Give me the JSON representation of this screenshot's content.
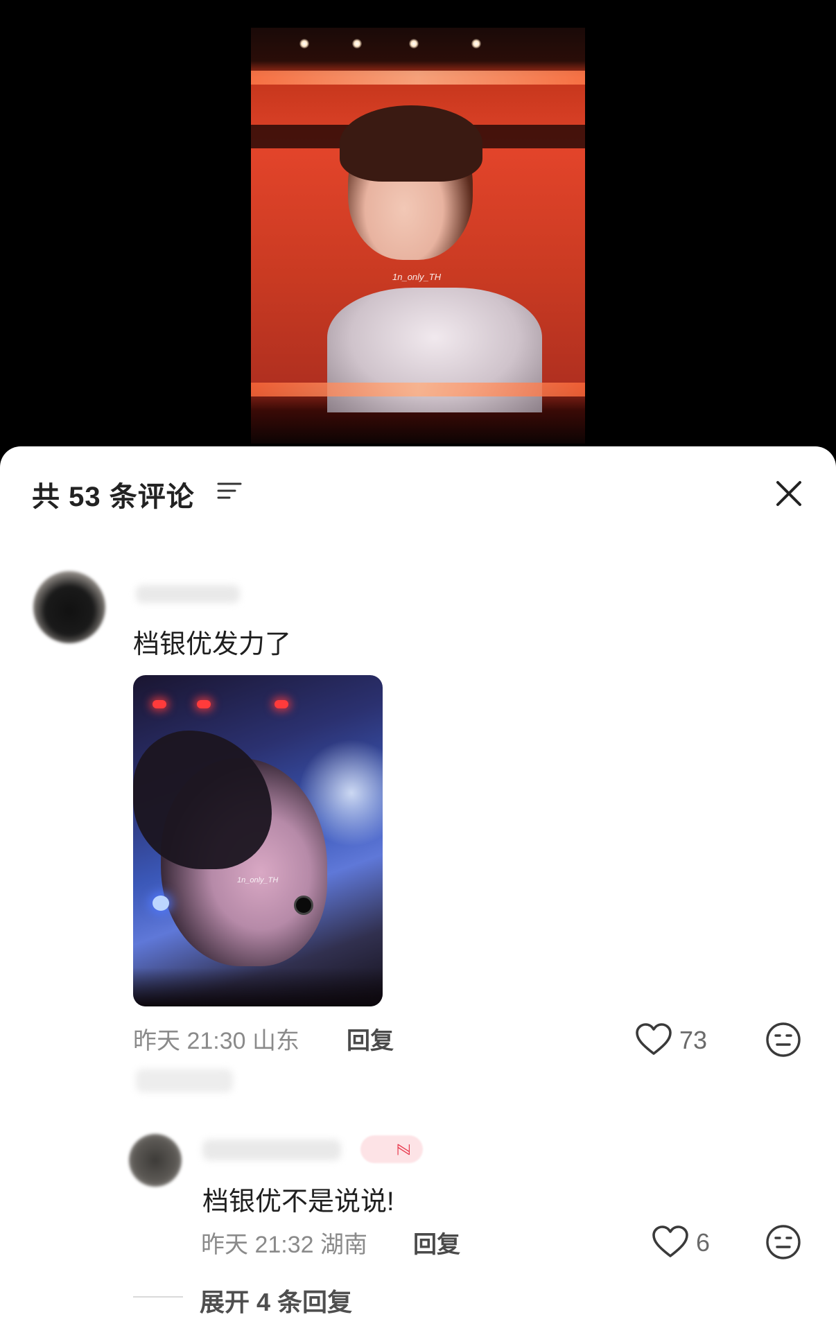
{
  "video": {
    "watermark": "1n_only_TH"
  },
  "sheet": {
    "title": "共 53 条评论"
  },
  "comments": [
    {
      "text": "档银优发力了",
      "image_watermark": "1n_only_TH",
      "time": "昨天 21:30",
      "location": "山东",
      "meta": "昨天 21:30 山东",
      "reply_label": "回复",
      "likes": "73"
    }
  ],
  "reply": {
    "text": "档银优不是说说!",
    "meta": "昨天 21:32 湖南",
    "reply_label": "回复",
    "likes": "6"
  },
  "expand": {
    "label": "展开 4 条回复"
  },
  "colors": {
    "sheet_bg": "#ffffff",
    "text_primary": "#1f1f1f",
    "text_meta": "#8a8a8a",
    "stage_red": "#e2442a",
    "badge_pink": "#fde3e6",
    "badge_red": "#e8364b"
  },
  "icons": [
    "filter-icon",
    "close-icon",
    "heart-icon",
    "dislike-face-icon"
  ]
}
